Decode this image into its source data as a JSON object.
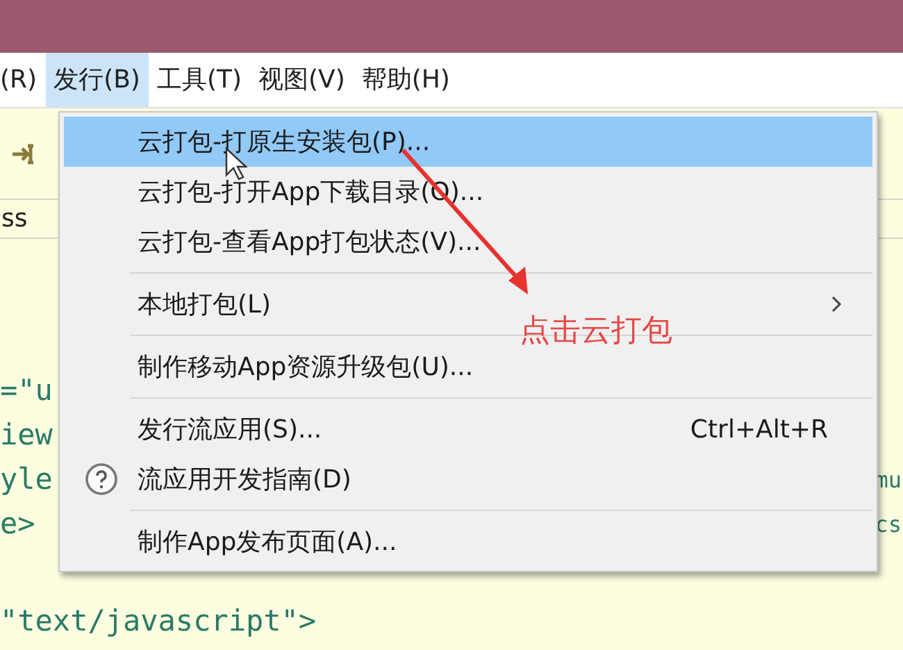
{
  "menubar": [
    {
      "label": "(R)",
      "selected": false
    },
    {
      "label": "发行(B)",
      "selected": true
    },
    {
      "label": "工具(T)",
      "selected": false
    },
    {
      "label": "视图(V)",
      "selected": false
    },
    {
      "label": "帮助(H)",
      "selected": false
    }
  ],
  "tab_fragment": "ss",
  "code_lines": [
    {
      "text": "=\"u"
    },
    {
      "text": "iew"
    },
    {
      "text": "yle",
      "right": "mu"
    },
    {
      "text": "e>",
      "right": "cs"
    },
    {
      "text": "\"text/javascript\">"
    }
  ],
  "menu": [
    {
      "kind": "item",
      "label": "云打包-打原生安装包(P)...",
      "selected": true
    },
    {
      "kind": "item",
      "label": "云打包-打开App下载目录(O)...",
      "selected": false
    },
    {
      "kind": "item",
      "label": "云打包-查看App打包状态(V)...",
      "selected": false
    },
    {
      "kind": "separator"
    },
    {
      "kind": "item",
      "label": "本地打包(L)",
      "submenu": true,
      "selected": false
    },
    {
      "kind": "separator"
    },
    {
      "kind": "item",
      "label": "制作移动App资源升级包(U)...",
      "selected": false
    },
    {
      "kind": "separator"
    },
    {
      "kind": "item",
      "label": "发行流应用(S)...",
      "shortcut": "Ctrl+Alt+R",
      "selected": false
    },
    {
      "kind": "help",
      "label": "流应用开发指南(D)",
      "selected": false
    },
    {
      "kind": "separator"
    },
    {
      "kind": "item",
      "label": "制作App发布页面(A)...",
      "selected": false
    }
  ],
  "annotation": {
    "text": "点击云打包"
  }
}
